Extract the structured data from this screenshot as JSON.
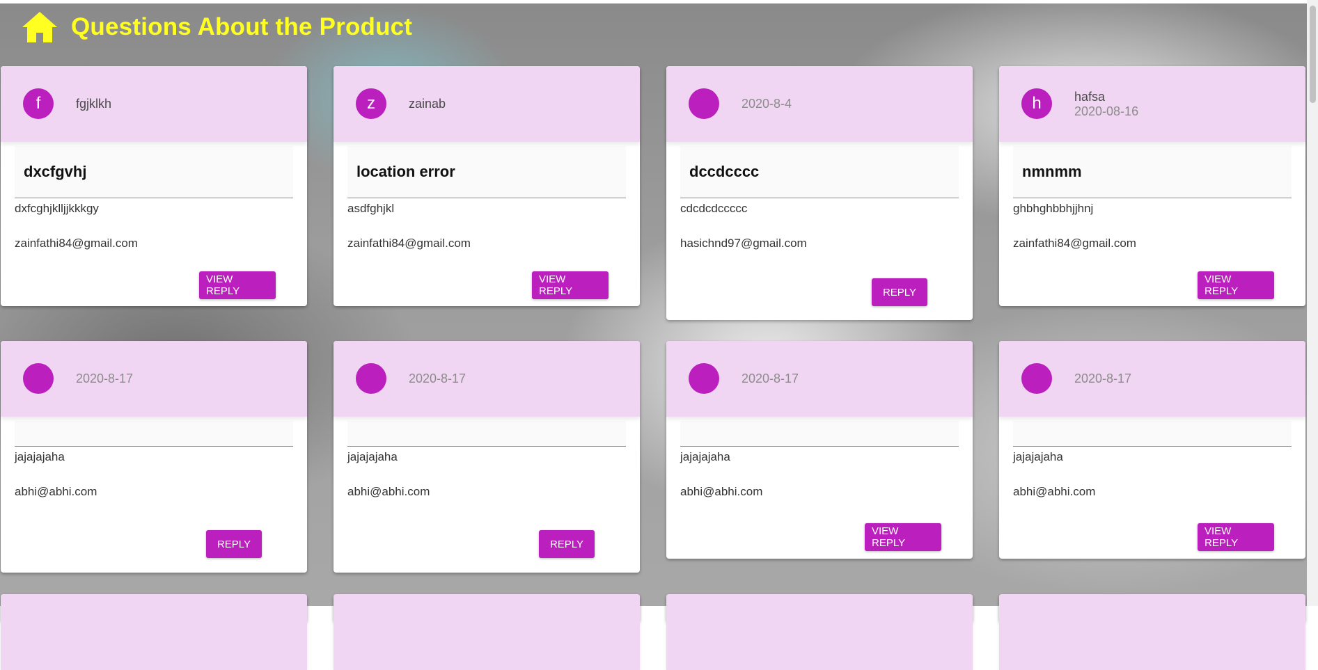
{
  "header": {
    "title": "Questions About the Product",
    "icon": "home-icon"
  },
  "colors": {
    "accent": "#bb1fbd",
    "card_header": "#f0d6f2",
    "title": "#ffff22"
  },
  "cards": [
    {
      "avatar": "f",
      "user": "fgjklkh",
      "date": "",
      "subject": "dxcfgvhj",
      "body": "dxfcghjklljjkkkgy",
      "email": "zainfathi84@gmail.com",
      "button": "VIEW REPLY"
    },
    {
      "avatar": "z",
      "user": "zainab",
      "date": "",
      "subject": "location error",
      "body": "asdfghjkl",
      "email": "zainfathi84@gmail.com",
      "button": "VIEW REPLY"
    },
    {
      "avatar": "",
      "user": "",
      "date": "2020-8-4",
      "subject": "dccdcccc",
      "body": "cdcdcdccccc",
      "email": "hasichnd97@gmail.com",
      "button": "REPLY"
    },
    {
      "avatar": "h",
      "user": "hafsa",
      "date": "2020-08-16",
      "subject": "nmnmm",
      "body": "ghbhghbbhjjhnj",
      "email": "zainfathi84@gmail.com",
      "button": "VIEW REPLY"
    },
    {
      "avatar": "",
      "user": "",
      "date": "2020-8-17",
      "subject": "",
      "body": "jajajajaha",
      "email": "abhi@abhi.com",
      "button": "REPLY"
    },
    {
      "avatar": "",
      "user": "",
      "date": "2020-8-17",
      "subject": "",
      "body": "jajajajaha",
      "email": "abhi@abhi.com",
      "button": "REPLY"
    },
    {
      "avatar": "",
      "user": "",
      "date": "2020-8-17",
      "subject": "",
      "body": "jajajajaha",
      "email": "abhi@abhi.com",
      "button": "VIEW REPLY"
    },
    {
      "avatar": "",
      "user": "",
      "date": "2020-8-17",
      "subject": "",
      "body": "jajajajaha",
      "email": "abhi@abhi.com",
      "button": "VIEW REPLY"
    }
  ]
}
